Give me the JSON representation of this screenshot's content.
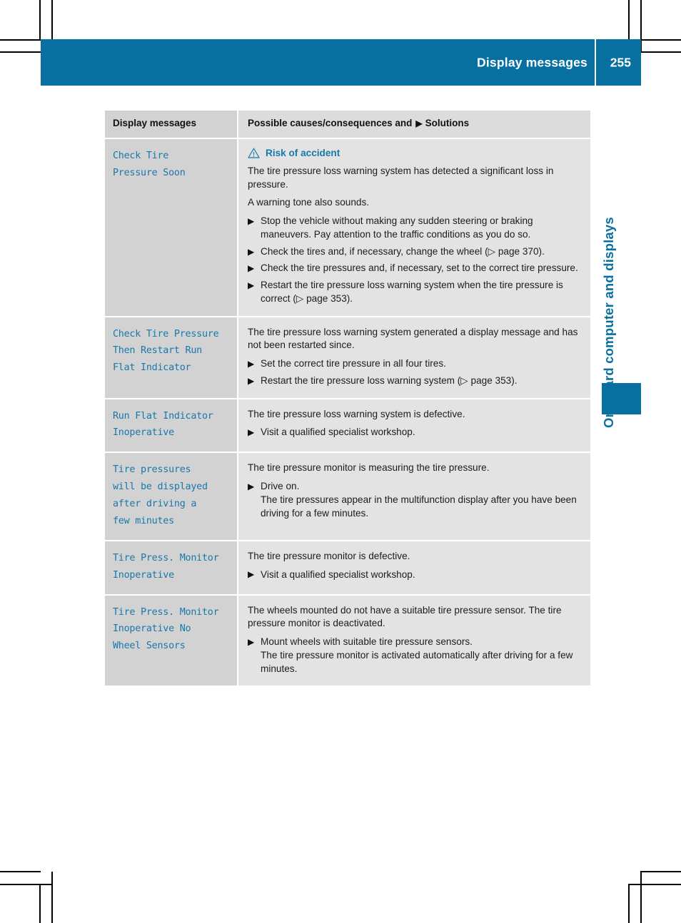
{
  "header": {
    "title": "Display messages",
    "page_number": "255"
  },
  "side_label": "On-board computer and displays",
  "table": {
    "columns": {
      "a": "Display messages",
      "b_prefix": "Possible causes/consequences and",
      "b_marker": "▶",
      "b_suffix": "Solutions"
    },
    "rows": [
      {
        "message": "Check Tire\nPressure Soon",
        "warning_title": "Risk of accident",
        "paragraphs": [
          "The tire pressure loss warning system has detected a significant loss in pressure.",
          "A warning tone also sounds."
        ],
        "bullets": [
          {
            "text": "Stop the vehicle without making any sudden steering or braking maneuvers. Pay attention to the traffic conditions as you do so."
          },
          {
            "text": "Check the tires and, if necessary, change the wheel (▷ page 370)."
          },
          {
            "text": "Check the tire pressures and, if necessary, set to the correct tire pressure."
          },
          {
            "text": "Restart the tire pressure loss warning system when the tire pressure is correct (▷ page 353)."
          }
        ]
      },
      {
        "message": "Check Tire Pressure\nThen Restart Run\nFlat Indicator",
        "paragraphs": [
          "The tire pressure loss warning system generated a display message and has not been restarted since."
        ],
        "bullets": [
          {
            "text": "Set the correct tire pressure in all four tires."
          },
          {
            "text": "Restart the tire pressure loss warning system (▷ page 353)."
          }
        ]
      },
      {
        "message": "Run Flat Indicator\nInoperative",
        "paragraphs": [
          "The tire pressure loss warning system is defective."
        ],
        "bullets": [
          {
            "text": "Visit a qualified specialist workshop."
          }
        ]
      },
      {
        "message": "Tire pressures\nwill be displayed\nafter driving a\nfew minutes",
        "paragraphs": [
          "The tire pressure monitor is measuring the tire pressure."
        ],
        "bullets": [
          {
            "text": "Drive on.",
            "sub": "The tire pressures appear in the multifunction display after you have been driving for a few minutes."
          }
        ]
      },
      {
        "message": "Tire Press. Monitor\nInoperative",
        "paragraphs": [
          "The tire pressure monitor is defective."
        ],
        "bullets": [
          {
            "text": "Visit a qualified specialist workshop."
          }
        ]
      },
      {
        "message": "Tire Press. Monitor\nInoperative No\nWheel Sensors",
        "paragraphs": [
          "The wheels mounted do not have a suitable tire pressure sensor. The tire pressure monitor is deactivated."
        ],
        "bullets": [
          {
            "text": "Mount wheels with suitable tire pressure sensors.",
            "sub": "The tire pressure monitor is activated automatically after driving for a few minutes."
          }
        ]
      }
    ]
  },
  "colors": {
    "brand_blue": "#0870a0",
    "message_blue": "#1878ac",
    "col_a_bg": "#d2d2d2",
    "col_b_bg": "#e3e3e3"
  },
  "bullet_marker": "▶"
}
